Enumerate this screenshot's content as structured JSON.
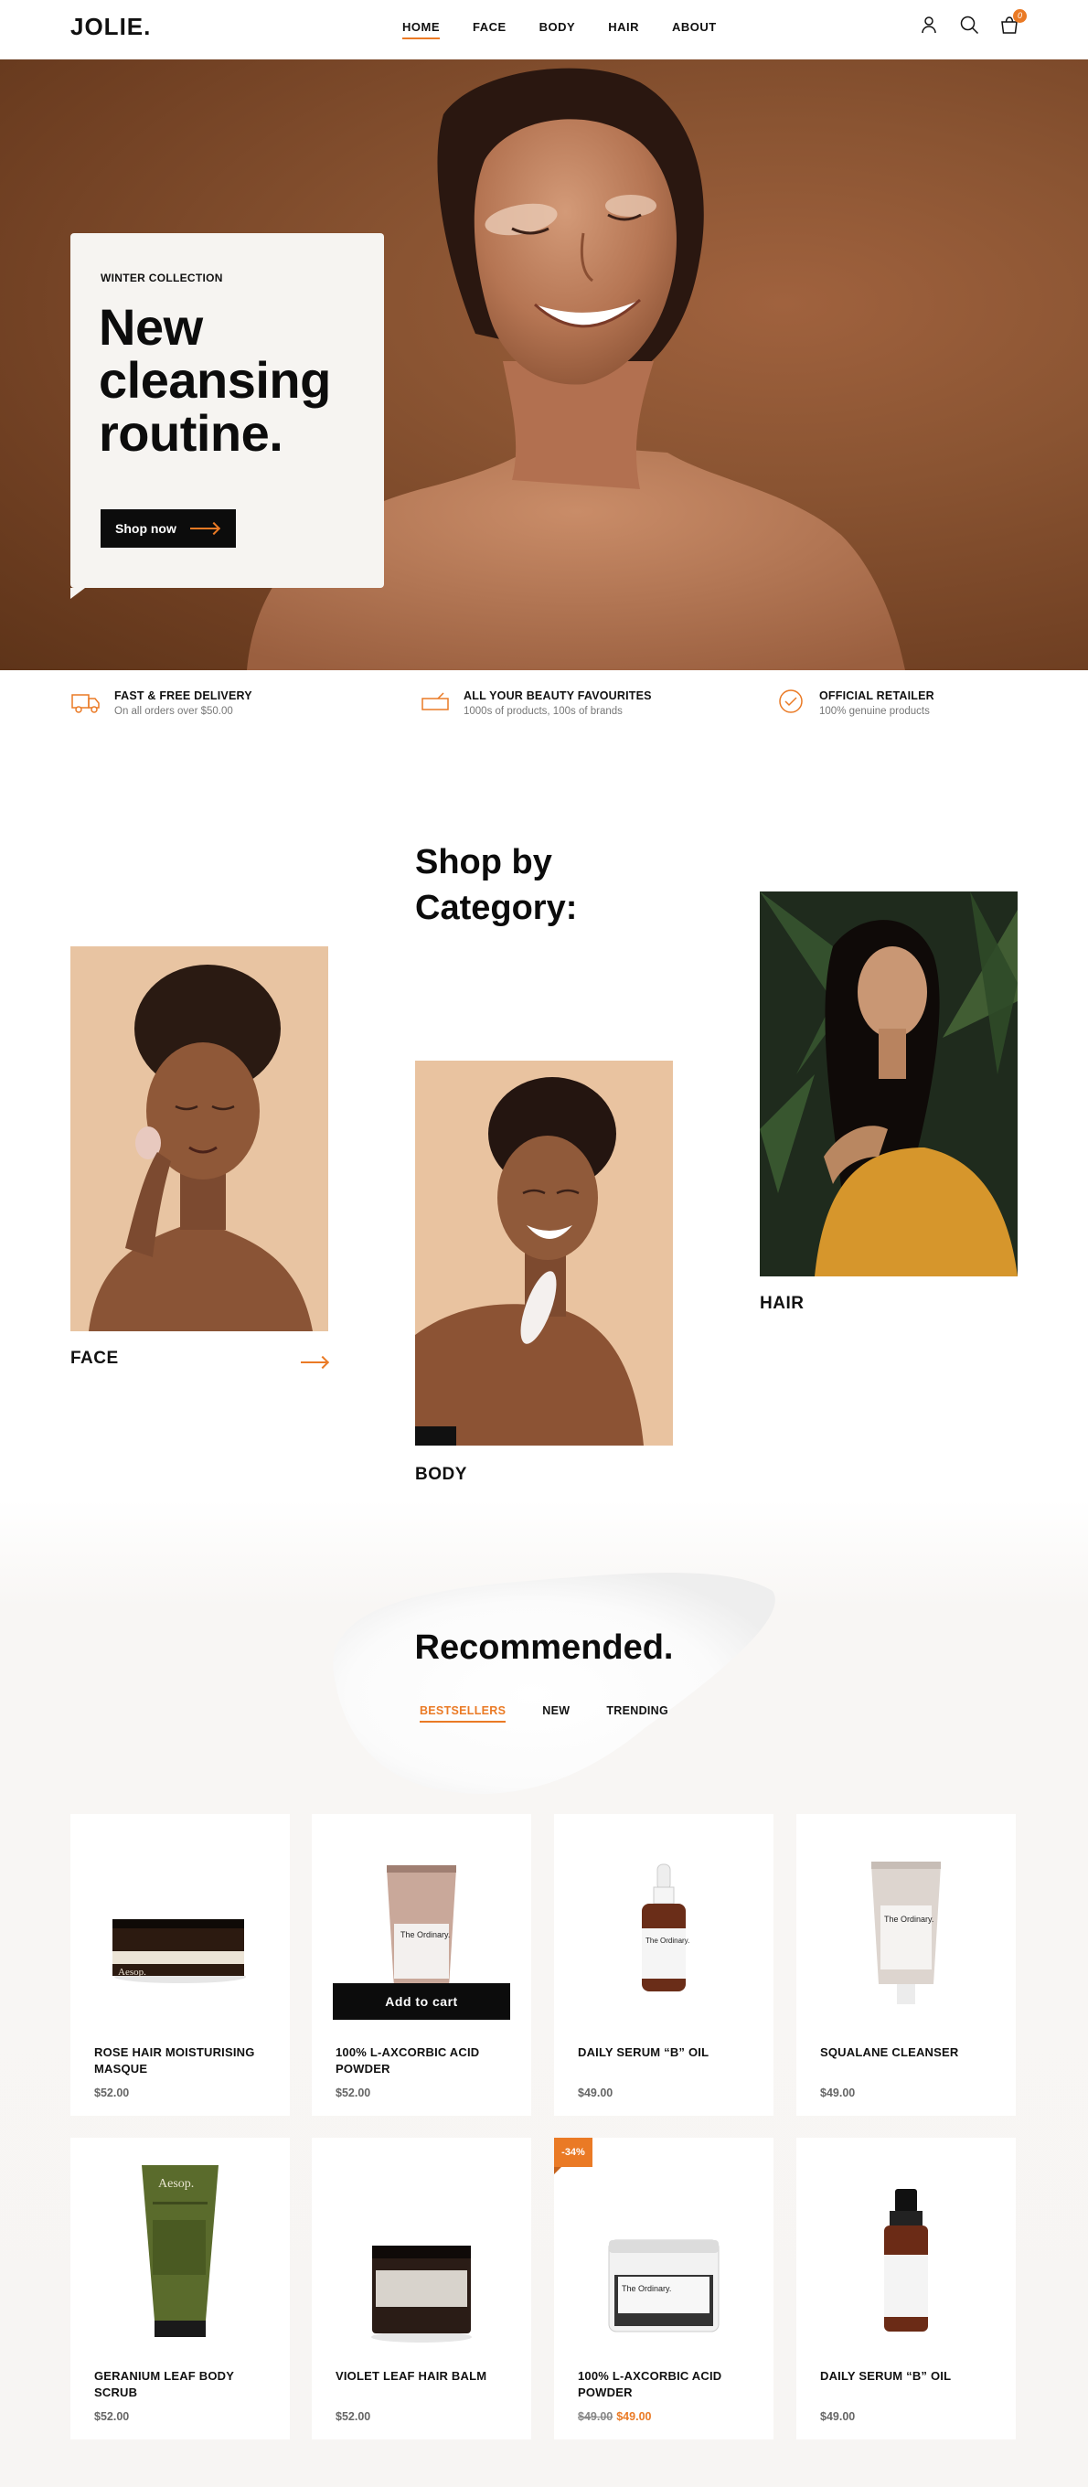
{
  "header": {
    "logo": "JOLIE.",
    "nav": [
      "HOME",
      "FACE",
      "BODY",
      "HAIR",
      "ABOUT"
    ],
    "active_nav": "HOME",
    "cart_count": "0",
    "icons": [
      "user-icon",
      "search-icon",
      "cart-icon"
    ]
  },
  "hero": {
    "eyebrow": "WINTER COLLECTION",
    "title": "New cleansing routine.",
    "button_label": "Shop now"
  },
  "usps": [
    {
      "title": "FAST & FREE DELIVERY",
      "subtitle": "On all orders over $50.00",
      "icon": "truck-icon"
    },
    {
      "title": "ALL YOUR BEAUTY FAVOURITES",
      "subtitle": "1000s of products, 100s of brands",
      "icon": "box-icon"
    },
    {
      "title": "OFFICIAL RETAILER",
      "subtitle": "100% genuine products",
      "icon": "check-circle-icon"
    }
  ],
  "categories": {
    "title": "Shop by Category:",
    "items": [
      {
        "label": "FACE"
      },
      {
        "label": "BODY"
      },
      {
        "label": "HAIR"
      }
    ]
  },
  "recommended": {
    "title": "Recommended.",
    "tabs": [
      "BESTSELLERS",
      "NEW",
      "TRENDING"
    ],
    "active_tab": "BESTSELLERS",
    "add_to_cart_label": "Add to cart",
    "products": [
      {
        "name": "ROSE HAIR MOISTURISING MASQUE",
        "price": "$52.00"
      },
      {
        "name": "100% L-AXCORBIC ACID POWDER",
        "price": "$52.00"
      },
      {
        "name": "DAILY SERUM  “B” OIL",
        "price": "$49.00"
      },
      {
        "name": "SQUALANE CLEANSER",
        "price": "$49.00"
      },
      {
        "name": "GERANIUM LEAF BODY SCRUB",
        "price": "$52.00"
      },
      {
        "name": "VIOLET LEAF HAIR BALM",
        "price": "$52.00"
      },
      {
        "name": "100% L-AXCORBIC ACID POWDER",
        "old_price": "$49.00",
        "price": "$49.00",
        "badge": "-34%"
      },
      {
        "name": "DAILY SERUM  “B” OIL",
        "price": "$49.00"
      }
    ],
    "product_labels": {
      "aesop": "Aesop.",
      "ordinary": "The Ordinary."
    }
  },
  "colors": {
    "accent": "#ea7a25",
    "dark": "#0c0c0c",
    "hero_bg": "#8a5432",
    "section_bg": "#f7f5f3"
  }
}
